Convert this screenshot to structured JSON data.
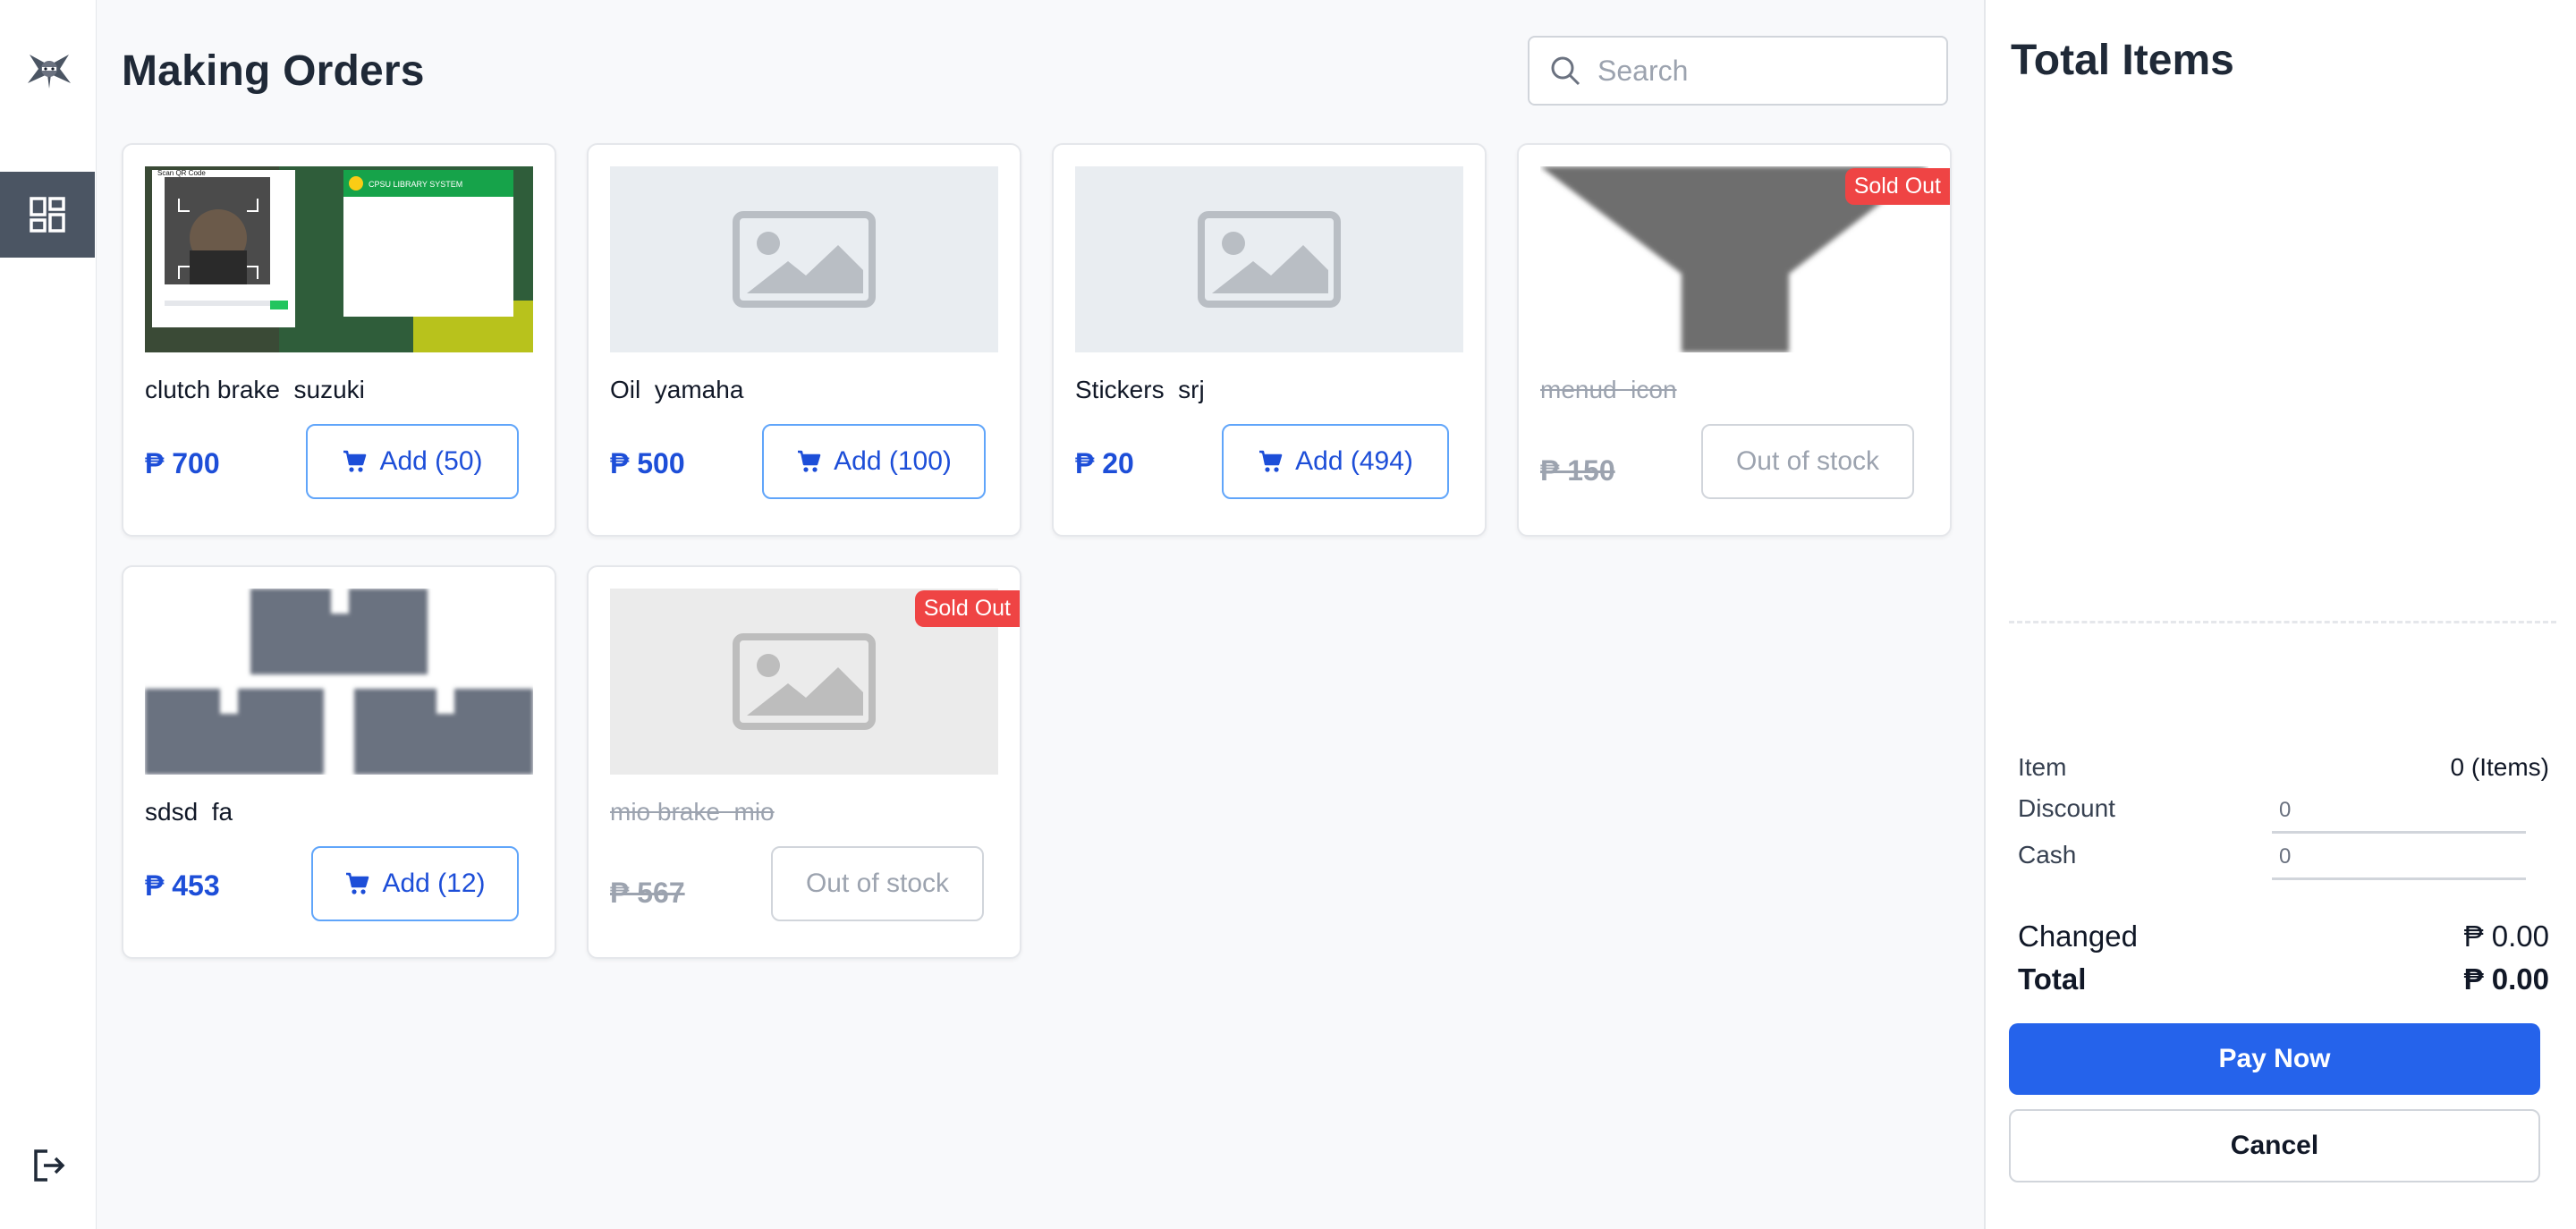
{
  "sidebar": {
    "logo_icon": "ninja-logo-icon",
    "nav_icon": "dashboard-grid-icon",
    "logout_icon": "logout-icon",
    "active_bg": "#4b5563"
  },
  "header": {
    "title": "Making Orders",
    "search_placeholder": "Search",
    "search_icon": "search-icon"
  },
  "products": [
    {
      "name": "clutch brake  suzuki",
      "price": "₱ 700",
      "button": "Add (50)",
      "image": "screenshot-qr-scanner",
      "sold_out": false
    },
    {
      "name": "Oil  yamaha",
      "price": "₱ 500",
      "button": "Add (100)",
      "image": "placeholder-image-icon",
      "sold_out": false
    },
    {
      "name": "Stickers  srj",
      "price": "₱ 20",
      "button": "Add (494)",
      "image": "placeholder-image-icon",
      "sold_out": false
    },
    {
      "name": "menud  icon",
      "price": "₱ 150",
      "button": "Out of stock",
      "badge": "Sold Out",
      "image": "blurred-funnel-icon",
      "sold_out": true
    },
    {
      "name": "sdsd  fa",
      "price": "₱ 453",
      "button": "Add (12)",
      "image": "blurred-boxes-icon",
      "sold_out": false
    },
    {
      "name": "mio brake  mio",
      "price": "₱ 567",
      "button": "Out of stock",
      "badge": "Sold Out",
      "image": "placeholder-image-icon",
      "sold_out": true
    }
  ],
  "screenshot_thumb": {
    "scan_title": "Scan QR Code",
    "library_title": "CPSU LIBRARY SYSTEM"
  },
  "summary": {
    "title": "Total Items",
    "item_label": "Item",
    "item_value": "0 (Items)",
    "discount_label": "Discount",
    "discount_placeholder": "0",
    "cash_label": "Cash",
    "cash_placeholder": "0",
    "changed_label": "Changed",
    "changed_value": "₱ 0.00",
    "total_label": "Total",
    "total_value": "₱ 0.00",
    "pay_label": "Pay Now",
    "cancel_label": "Cancel"
  },
  "colors": {
    "primary": "#2563eb",
    "price": "#1d4ed8",
    "sold_out": "#ef4444",
    "muted": "#9ca3af"
  }
}
